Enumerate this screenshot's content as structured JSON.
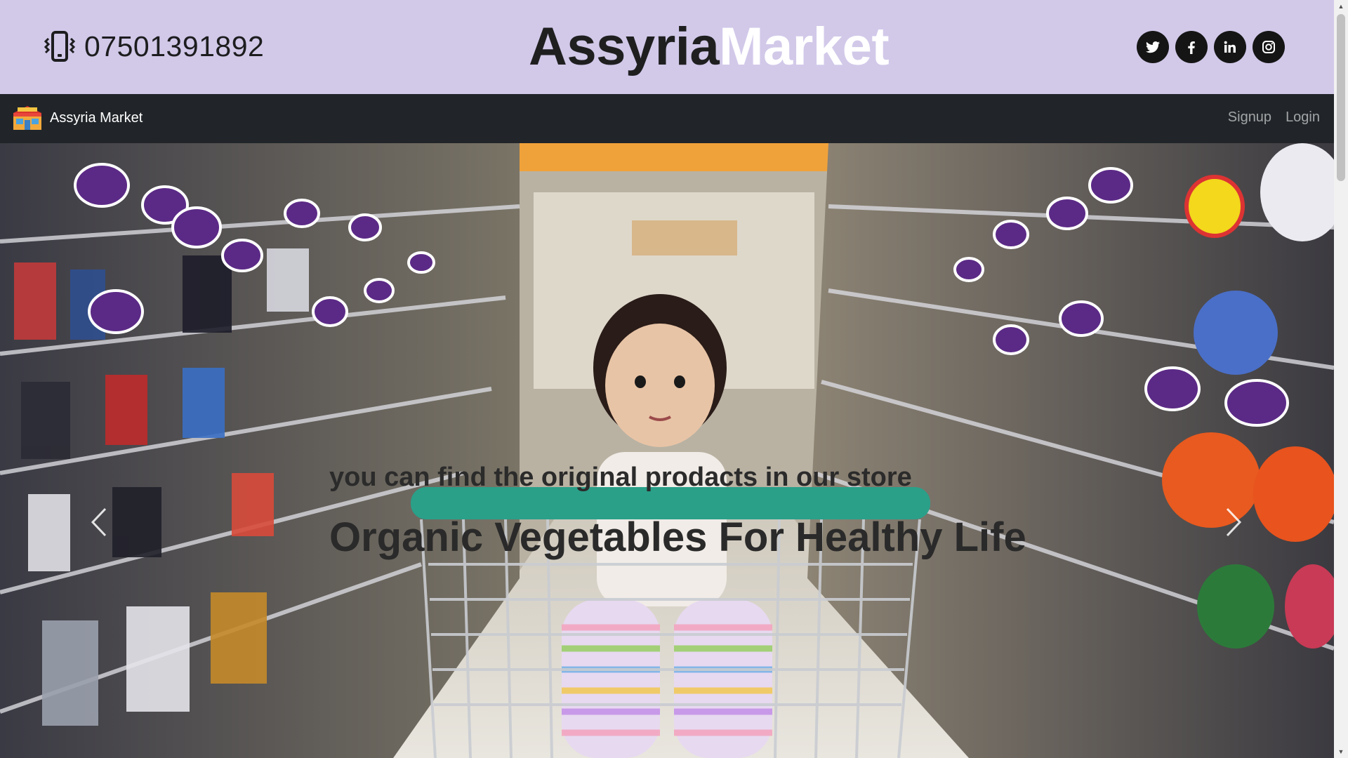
{
  "header": {
    "phone_number": "07501391892",
    "brand_part1": "Assyria",
    "brand_part2": "Market",
    "socials": [
      "twitter-icon",
      "facebook-icon",
      "linkedin-icon",
      "instagram-icon"
    ]
  },
  "navbar": {
    "brand": "Assyria Market",
    "links": [
      "Signup",
      "Login"
    ]
  },
  "hero": {
    "subtitle": "you can find the original prodacts in our store",
    "title": "Organic Vegetables For Healthy Life",
    "prev_icon": "chevron-left-icon",
    "next_icon": "chevron-right-icon"
  },
  "colors": {
    "header_bg": "#d2c9e9",
    "navbar_bg": "#212529",
    "brand_dark": "#1f1f20",
    "brand_light": "#ffffff",
    "nav_link": "rgba(255,255,255,0.58)"
  }
}
